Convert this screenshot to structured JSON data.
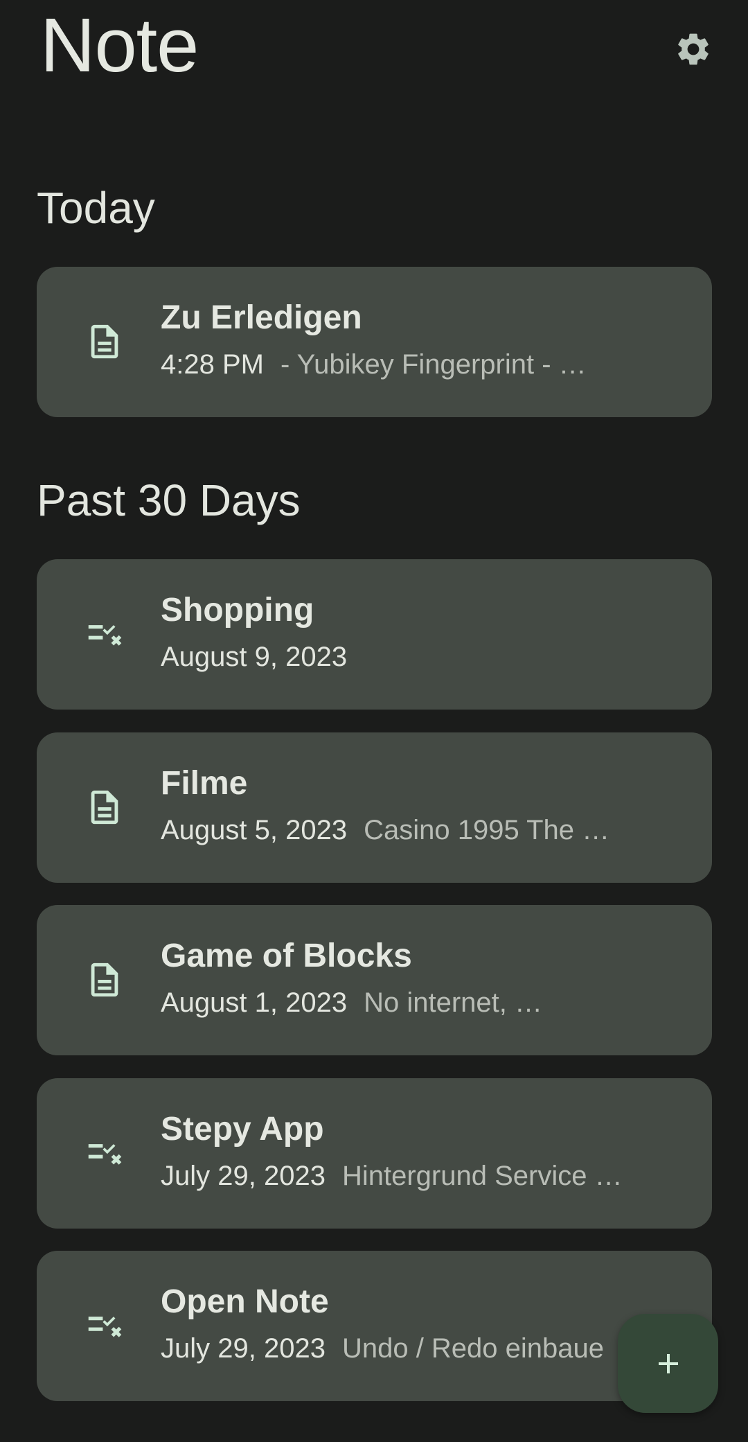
{
  "app": {
    "title": "Note"
  },
  "colors": {
    "background": "#1b1c1b",
    "card": "#444a44",
    "icon_accent": "#cfe9d6",
    "fab": "#344838",
    "text_primary": "#e3e6df",
    "text_secondary": "#b9bdb6"
  },
  "header": {
    "settings_icon": "gear-icon"
  },
  "sections": {
    "today": {
      "label": "Today",
      "notes": [
        {
          "icon": "document-icon",
          "title": "Zu Erledigen",
          "date": "4:28 PM",
          "preview": "- Yubikey Fingerprint  - …"
        }
      ]
    },
    "past": {
      "label": "Past 30 Days",
      "notes": [
        {
          "icon": "checklist-icon",
          "title": "Shopping",
          "date": "August 9, 2023",
          "preview": ""
        },
        {
          "icon": "document-icon",
          "title": "Filme",
          "date": "August 5, 2023",
          "preview": "Casino 1995 The …"
        },
        {
          "icon": "document-icon",
          "title": "Game of Blocks",
          "date": "August 1, 2023",
          "preview": "No internet, …"
        },
        {
          "icon": "checklist-icon",
          "title": "Stepy App",
          "date": "July 29, 2023",
          "preview": "Hintergrund Service …"
        },
        {
          "icon": "checklist-icon",
          "title": "Open Note",
          "date": "July 29, 2023",
          "preview": "Undo / Redo einbaue"
        }
      ]
    }
  },
  "fab": {
    "icon": "plus-icon"
  }
}
